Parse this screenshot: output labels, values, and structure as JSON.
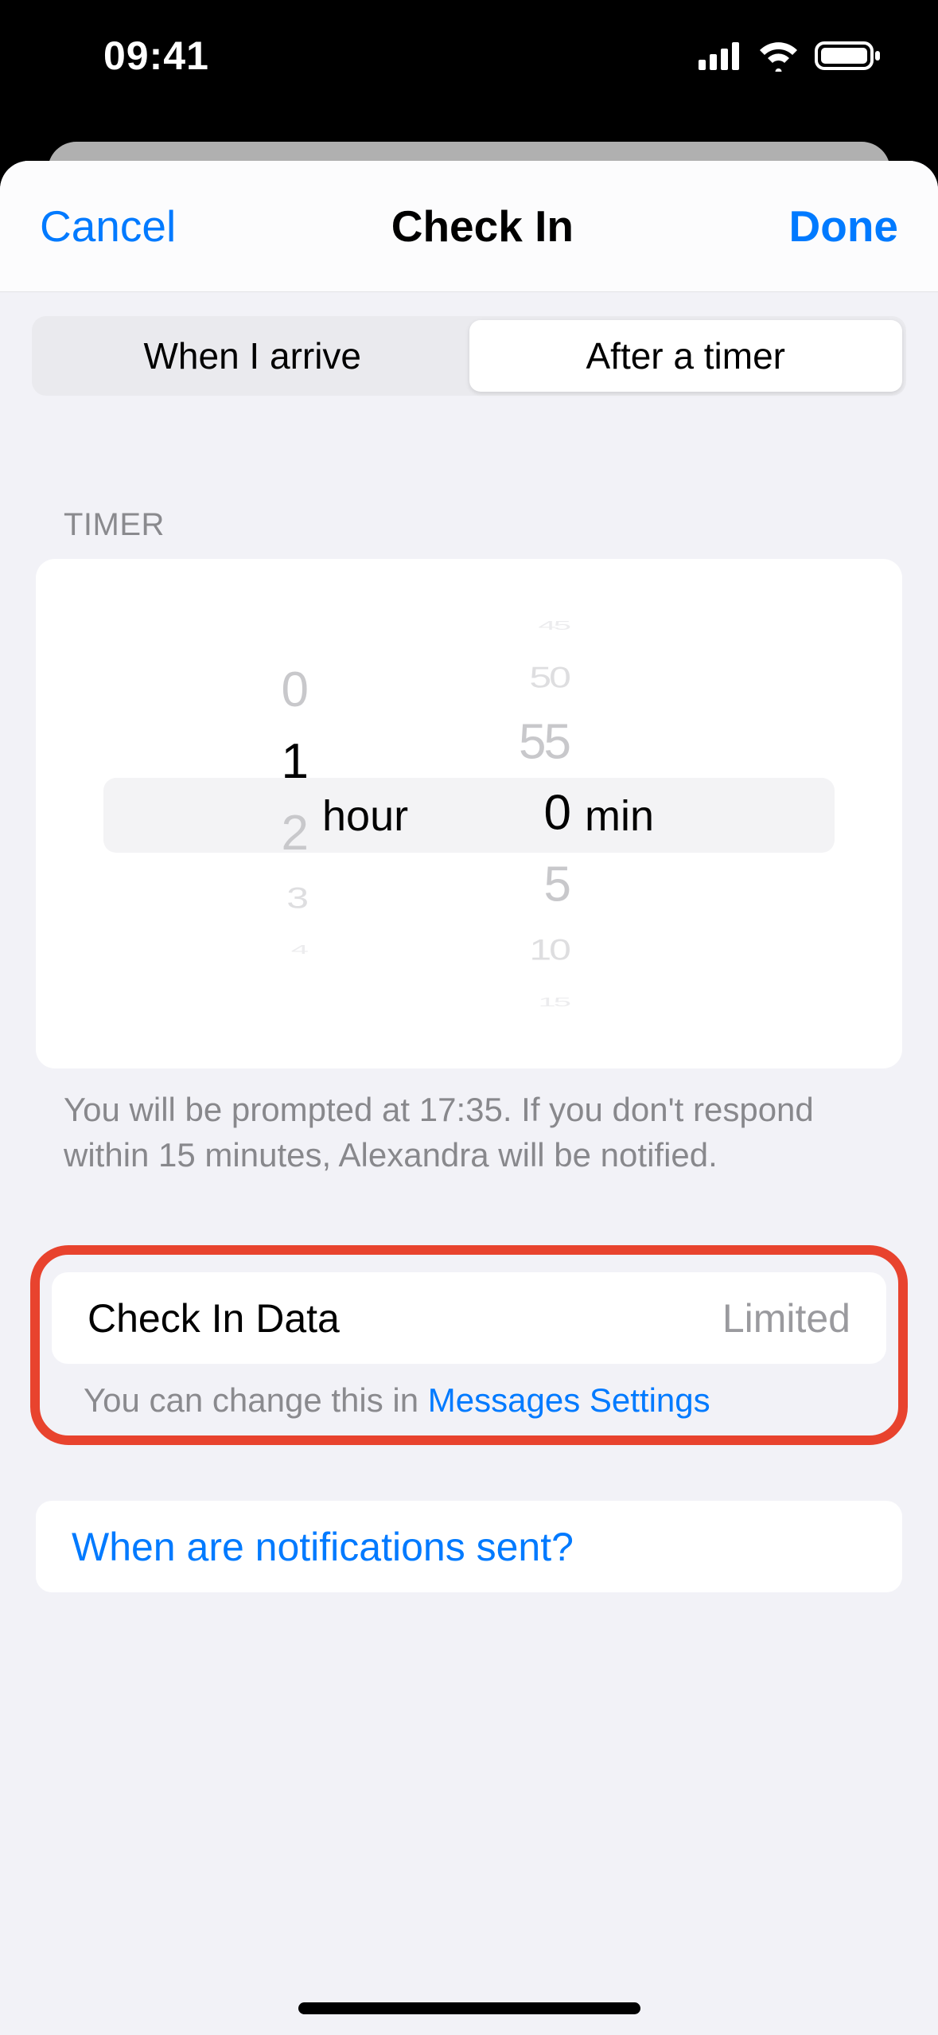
{
  "statusBar": {
    "time": "09:41"
  },
  "nav": {
    "cancel": "Cancel",
    "title": "Check In",
    "done": "Done"
  },
  "segmented": {
    "option1": "When I arrive",
    "option2": "After a timer"
  },
  "timer": {
    "header": "TIMER",
    "hour": {
      "values": [
        "0",
        "1",
        "2",
        "3",
        "4"
      ],
      "label": "hour"
    },
    "min": {
      "values": [
        "45",
        "50",
        "55",
        "0",
        "5",
        "10",
        "15"
      ],
      "label": "min"
    },
    "footer": "You will be prompted at 17:35. If you don't respond within 15 minutes, Alexandra will be notified."
  },
  "data": {
    "label": "Check In Data",
    "value": "Limited",
    "footerPrefix": "You can change this in ",
    "footerLink": "Messages Settings"
  },
  "info": {
    "label": "When are notifications sent?"
  }
}
